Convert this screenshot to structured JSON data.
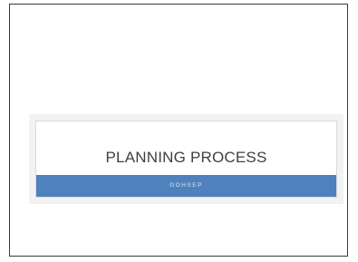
{
  "slide": {
    "title": "PLANNING PROCESS",
    "subtitle": "GOHSEP"
  },
  "colors": {
    "subtitle_bar": "#4f81bd",
    "title_text": "#404040",
    "subtitle_text": "#dbe5f1",
    "band": "#f2f2f2",
    "frame_border": "#3a3a3a"
  }
}
